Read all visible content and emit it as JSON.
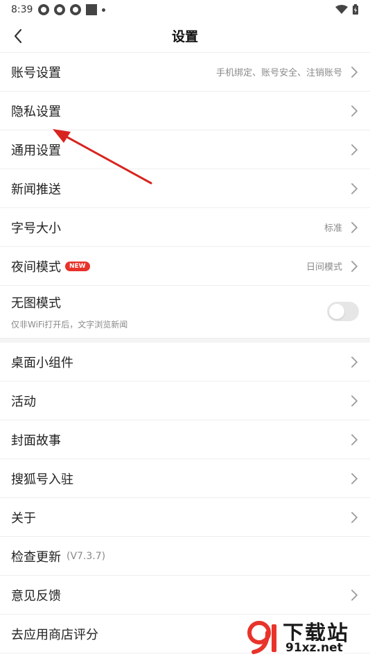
{
  "status_bar": {
    "time": "8:39"
  },
  "header": {
    "title": "设置"
  },
  "items": [
    {
      "label": "账号设置",
      "hint": "手机绑定、账号安全、注销账号"
    },
    {
      "label": "隐私设置"
    },
    {
      "label": "通用设置"
    },
    {
      "label": "新闻推送"
    },
    {
      "label": "字号大小",
      "hint": "标准"
    },
    {
      "label": "夜间模式",
      "badge": "NEW",
      "hint": "日间模式"
    },
    {
      "label": "无图模式",
      "sub": "仅非WiFi打开后，文字浏览新闻",
      "toggle_on": false
    }
  ],
  "items2": [
    {
      "label": "桌面小组件"
    },
    {
      "label": "活动"
    },
    {
      "label": "封面故事"
    },
    {
      "label": "搜狐号入驻"
    },
    {
      "label": "关于"
    },
    {
      "label": "检查更新",
      "version": "(V7.3.7)"
    },
    {
      "label": "意见反馈"
    },
    {
      "label": "去应用商店评分"
    }
  ],
  "watermark": {
    "text": "下载站",
    "url": "91xz.net"
  },
  "colors": {
    "accent": "#e8332a",
    "divider": "#eeeeee",
    "hint": "#8a8a8a"
  }
}
